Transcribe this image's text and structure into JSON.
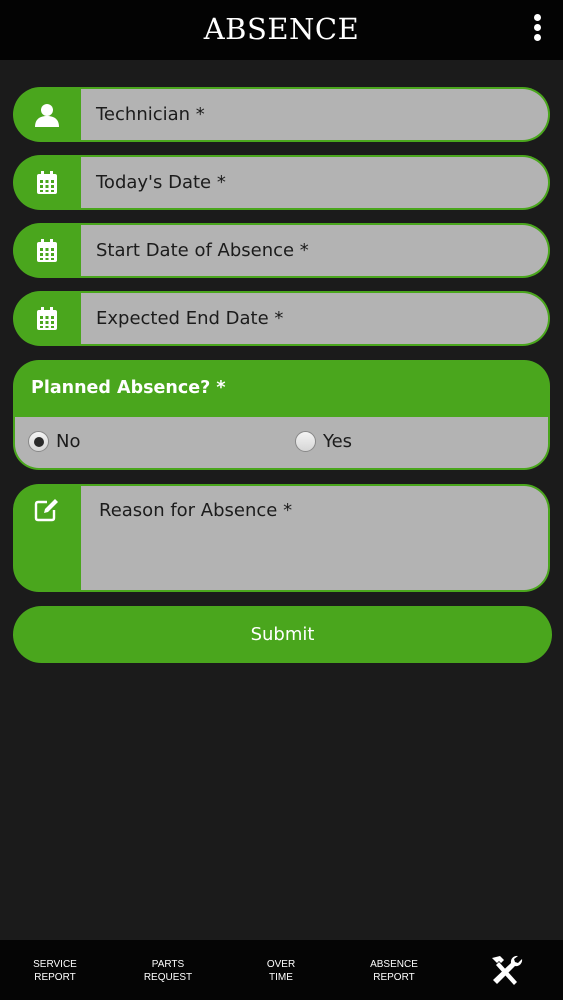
{
  "header": {
    "title": "ABSENCE",
    "menu_icon": "more-vertical-icon"
  },
  "form": {
    "technician": {
      "label": "Technician *",
      "icon": "user-icon"
    },
    "todays_date": {
      "label": "Today's Date *",
      "icon": "calendar-icon"
    },
    "start_date": {
      "label": "Start Date of Absence *",
      "icon": "calendar-icon"
    },
    "end_date": {
      "label": "Expected End Date *",
      "icon": "calendar-icon"
    },
    "planned": {
      "label": "Planned Absence? *",
      "options": [
        {
          "label": "No",
          "checked": true
        },
        {
          "label": "Yes",
          "checked": false
        }
      ]
    },
    "reason": {
      "label": "Reason for Absence *",
      "icon": "edit-icon"
    },
    "submit_label": "Submit"
  },
  "bottom_nav": {
    "items": [
      {
        "line1": "SERVICE",
        "line2": "REPORT"
      },
      {
        "line1": "PARTS",
        "line2": "REQUEST"
      },
      {
        "line1": "OVER",
        "line2": "TIME"
      },
      {
        "line1": "ABSENCE",
        "line2": "REPORT"
      }
    ],
    "tools_icon": "tools-icon"
  },
  "colors": {
    "accent": "#4aa61d",
    "field_bg": "#b3b3b3",
    "background": "#1b1b1b"
  }
}
